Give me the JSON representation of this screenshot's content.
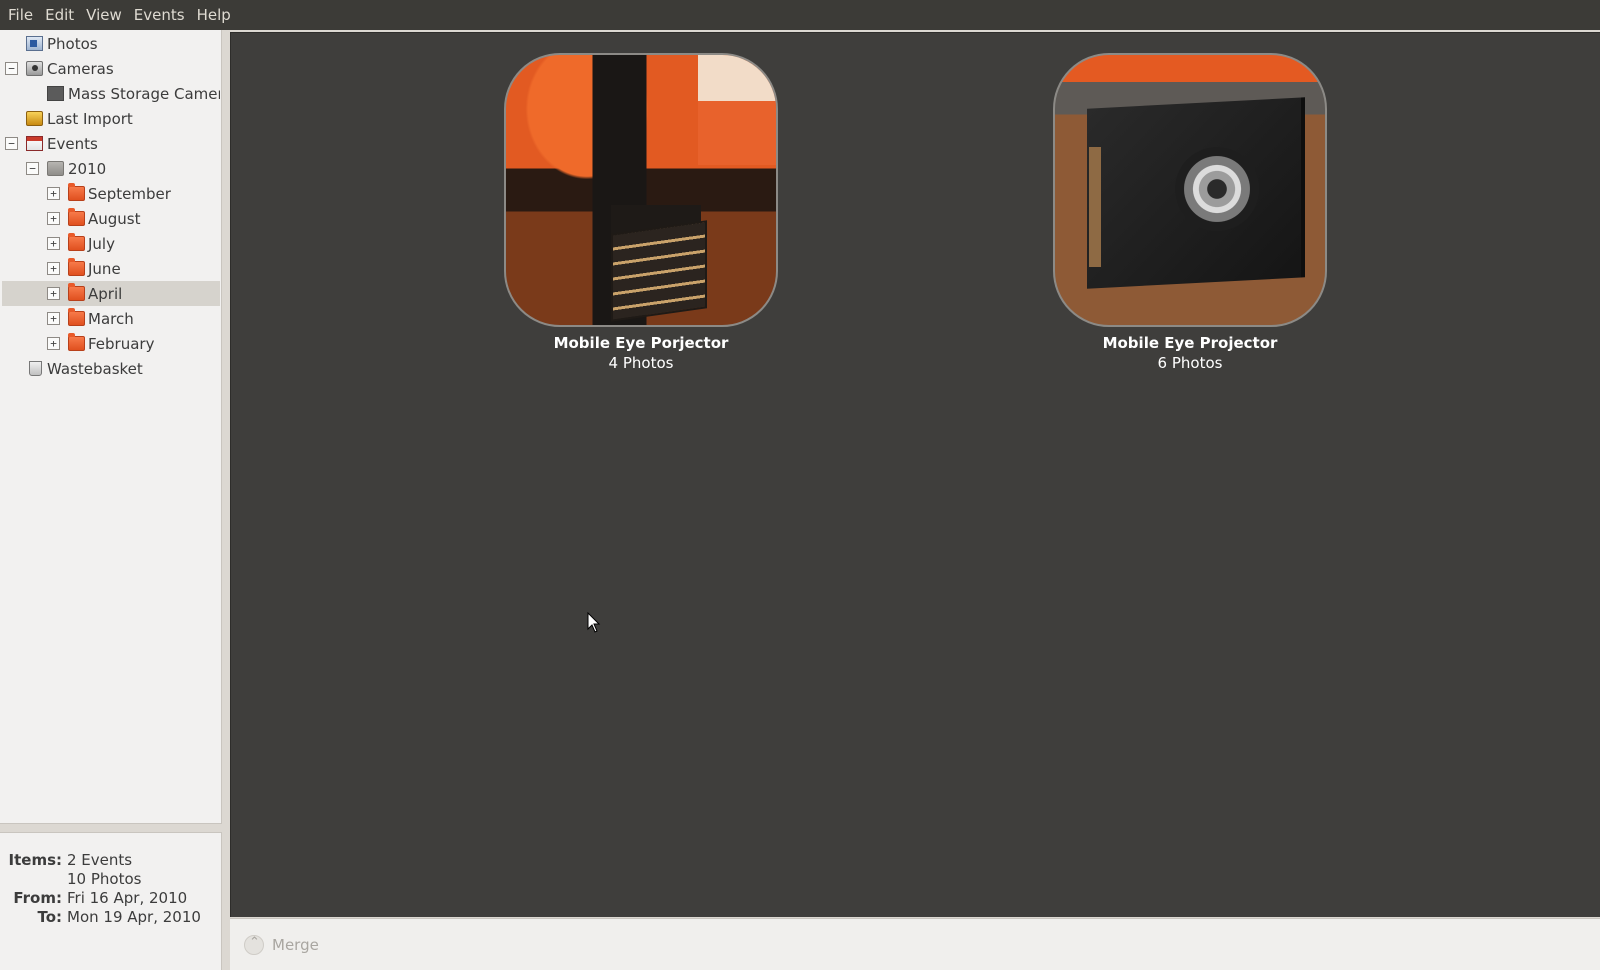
{
  "menu": [
    "File",
    "Edit",
    "View",
    "Events",
    "Help"
  ],
  "sidebar": {
    "photos": "Photos",
    "cameras": "Cameras",
    "camera_device": "Mass Storage Camera",
    "last_import": "Last Import",
    "events": "Events",
    "year": "2010",
    "months": [
      "September",
      "August",
      "July",
      "June",
      "April",
      "March",
      "February"
    ],
    "selected_month": "April",
    "wastebasket": "Wastebasket",
    "expand_symbol": "+",
    "collapse_symbol": "−"
  },
  "info": {
    "items_label": "Items:",
    "items_events": "2 Events",
    "items_photos": "10 Photos",
    "from_label": "From:",
    "from_value": "Fri 16 Apr, 2010",
    "to_label": "To:",
    "to_value": "Mon 19 Apr, 2010"
  },
  "events": [
    {
      "title": "Mobile Eye Porjector",
      "count": "4 Photos"
    },
    {
      "title": "Mobile Eye Projector",
      "count": "6 Photos"
    }
  ],
  "toolbar": {
    "merge_label": "Merge"
  },
  "colors": {
    "menubar": "#3c3b37",
    "main_bg": "#3f3e3c",
    "sidebar_bg": "#f2f1f0",
    "selected_row": "#d6d3cd"
  }
}
